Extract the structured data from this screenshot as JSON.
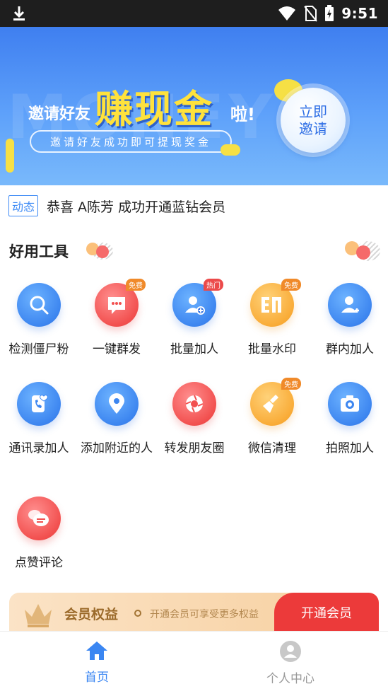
{
  "status_bar": {
    "time": "9:51",
    "icons": [
      "download-icon",
      "wifi-icon",
      "no-sim-icon",
      "battery-charging-icon"
    ]
  },
  "banner": {
    "ghost_text": "MONEY",
    "invite_prefix": "邀请好友",
    "headline": "赚现金",
    "suffix": "啦!",
    "subtitle": "邀请好友成功即可提现奖金",
    "cta_line1": "立即",
    "cta_line2": "邀请"
  },
  "ticker": {
    "tag": "动态",
    "message": "恭喜 A陈芳 成功开通蓝钻会员"
  },
  "tools_section": {
    "title": "好用工具",
    "items": [
      {
        "label": "检测僵尸粉",
        "icon": "magnifier-icon",
        "color": "blue",
        "badge": ""
      },
      {
        "label": "一键群发",
        "icon": "chat-bubble-icon",
        "color": "red",
        "badge": "免费"
      },
      {
        "label": "批量加人",
        "icon": "add-person-icon",
        "color": "blue",
        "badge": "热门"
      },
      {
        "label": "批量水印",
        "icon": "watermark-icon",
        "color": "orange",
        "badge": "免费"
      },
      {
        "label": "群内加人",
        "icon": "group-add-person-icon",
        "color": "blue",
        "badge": ""
      },
      {
        "label": "通讯录加人",
        "icon": "phone-contact-icon",
        "color": "blue",
        "badge": ""
      },
      {
        "label": "添加附近的人",
        "icon": "location-pin-icon",
        "color": "blue",
        "badge": ""
      },
      {
        "label": "转发朋友圈",
        "icon": "aperture-icon",
        "color": "red",
        "badge": ""
      },
      {
        "label": "微信清理",
        "icon": "broom-icon",
        "color": "orange",
        "badge": "免费"
      },
      {
        "label": "拍照加人",
        "icon": "camera-icon",
        "color": "blue",
        "badge": ""
      },
      {
        "label": "点赞评论",
        "icon": "comment-icon",
        "color": "red",
        "badge": ""
      }
    ]
  },
  "member": {
    "title": "会员权益",
    "subtitle": "开通会员可享受更多权益",
    "button": "开通会员"
  },
  "bottom_nav": {
    "home": "首页",
    "profile": "个人中心"
  }
}
